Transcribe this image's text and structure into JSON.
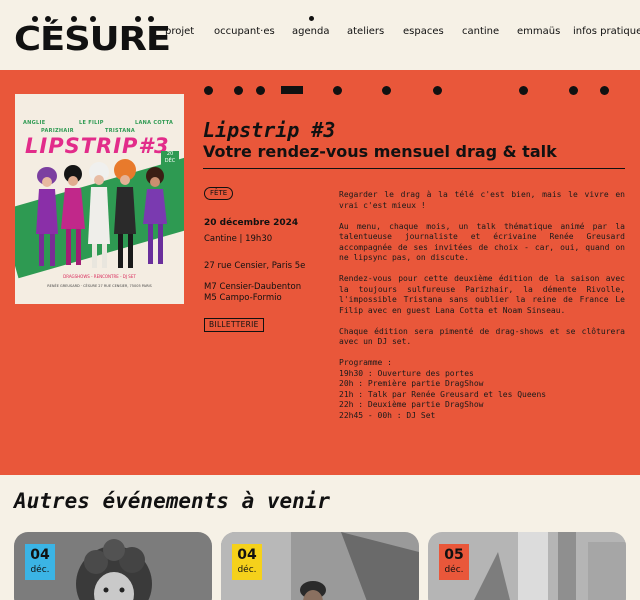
{
  "site": {
    "logo": "CÉSURE"
  },
  "nav": [
    {
      "label": "projet"
    },
    {
      "label": "occupant·es"
    },
    {
      "label": "agenda"
    },
    {
      "label": "ateliers"
    },
    {
      "label": "espaces"
    },
    {
      "label": "cantine"
    },
    {
      "label": "emmaüs"
    },
    {
      "label": "infos pratiques"
    }
  ],
  "event": {
    "title": "Lipstrip #3",
    "subtitle": "Votre rendez-vous mensuel drag & talk",
    "tag": "FÊTE",
    "date": "20 décembre 2024",
    "time": "Cantine | 19h30",
    "address": "27 rue Censier, Paris 5e",
    "metro1": "M7 Censier-Daubenton",
    "metro2": "M5 Campo-Formio",
    "ticket": "BILLETTERIE",
    "paragraphs": [
      "Regarder le drag à la télé c'est bien, mais le vivre en vrai c'est mieux !",
      "Au menu, chaque mois, un talk thématique animé par la talentueuse journaliste et écrivaine Renée Greusard accompagnée de ses invitées de choix - car, oui, quand on ne lipsync pas, on discute.",
      "Rendez-vous pour cette deuxième édition de la saison avec la toujours sulfureuse Parizhair, la démente Rivolle, l'impossible Tristana sans oublier la reine de France Le Filip avec en guest Lana Cotta et Noam Sinseau.",
      "Chaque édition sera pimenté de drag-shows et se clôturera avec un DJ set."
    ],
    "program_title": "Programme :",
    "program": [
      "19h30 : Ouverture des portes",
      "20h : Première partie DragShow",
      "21h : Talk par Renée Greusard et les Queens",
      "22h : Deuxième partie DragShow",
      "22h45 - 00h : DJ Set"
    ]
  },
  "poster": {
    "names_row1": [
      "ANGLIE",
      "LE FILIP",
      "LANA COTTA"
    ],
    "names_row2": [
      "PARIZHAIR",
      "TRISTANA"
    ],
    "title": "LIPSTRIP#3",
    "badge": "20 DÉC",
    "footer": "DRAGSHOWS - RENCONTRE - DJ SET",
    "footer2": "RENÉE GREUSARD · CÉSURE 27 RUE CENSIER, 75005 PARIS"
  },
  "upcoming": {
    "title": "Autres événements à venir",
    "cards": [
      {
        "day": "04",
        "month": "déc.",
        "badge_color": "#3bb4e5"
      },
      {
        "day": "04",
        "month": "déc.",
        "badge_color": "#f5d11b"
      },
      {
        "day": "05",
        "month": "déc.",
        "badge_color": "#e9573a"
      }
    ]
  },
  "colors": {
    "background": "#f6f1e6",
    "hero": "#e9573a",
    "text": "#111111"
  }
}
